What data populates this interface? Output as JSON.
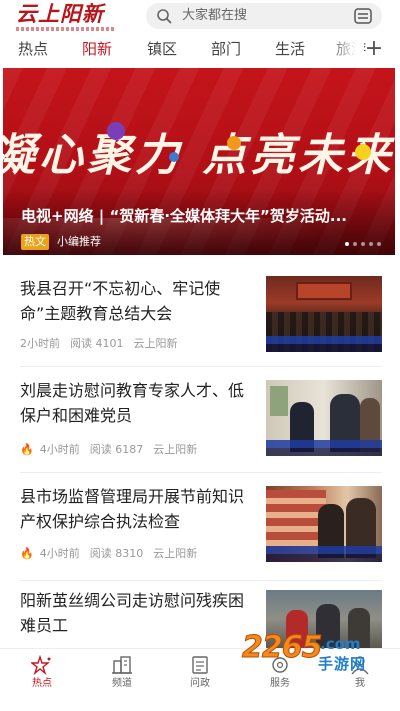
{
  "header": {
    "logo_text": "云上阳新",
    "search_placeholder": "大家都在搜"
  },
  "tabs": [
    "热点",
    "阳新",
    "镇区",
    "部门",
    "生活",
    "旅游"
  ],
  "active_tab": "阳新",
  "banner": {
    "slogan": "凝心聚力 点亮未来",
    "title": "电视+网络 | “贺新春·全媒体拜大年”贺岁活动...",
    "badge": "热文",
    "source": "小编推荐"
  },
  "news": [
    {
      "title": "我县召开“不忘初心、牢记使命”主题教育总结大会",
      "time": "2小时前",
      "reads": "阅读 4101",
      "source": "云上阳新",
      "hot": false
    },
    {
      "title": "刘晨走访慰问教育专家人才、低保户和困难党员",
      "time": "4小时前",
      "reads": "阅读 6187",
      "source": "云上阳新",
      "hot": true
    },
    {
      "title": "县市场监督管理局开展节前知识产权保护综合执法检查",
      "time": "4小时前",
      "reads": "阅读 8310",
      "source": "云上阳新",
      "hot": true
    },
    {
      "title": "阳新茧丝绸公司走访慰问残疾困难员工",
      "time": "",
      "reads": "",
      "source": "",
      "hot": false
    }
  ],
  "bottom_nav": [
    {
      "label": "热点",
      "icon": "star-sparkle-icon",
      "active": true
    },
    {
      "label": "频道",
      "icon": "buildings-icon",
      "active": false
    },
    {
      "label": "问政",
      "icon": "document-icon",
      "active": false
    },
    {
      "label": "服务",
      "icon": "service-icon",
      "active": false
    },
    {
      "label": "我",
      "icon": "user-icon",
      "active": false
    }
  ],
  "watermark": {
    "num": "2265",
    "com": ".com",
    "cn": "手游网"
  },
  "colors": {
    "accent": "#c4161d",
    "banner_red": "#c5141b",
    "badge_orange": "#e9a21a"
  }
}
